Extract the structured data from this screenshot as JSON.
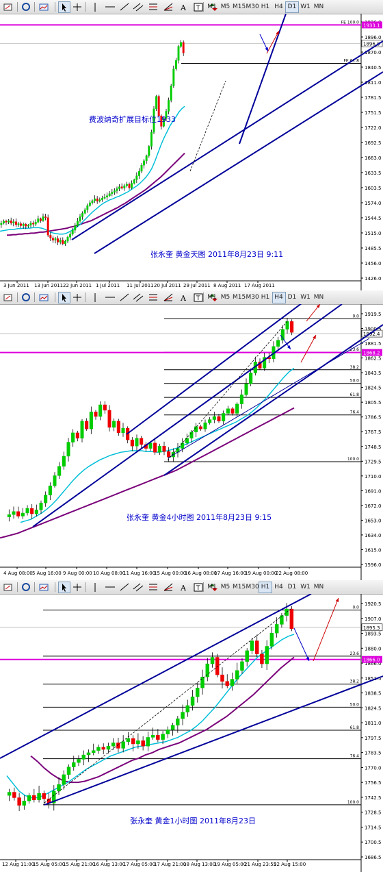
{
  "toolbar": {
    "timeframes": [
      "M1",
      "M5",
      "M15",
      "M30",
      "H1",
      "H4",
      "D1",
      "W1",
      "MN"
    ],
    "tools": [
      "new-order-icon",
      "zoom-icon",
      "chart-icon",
      "cursor-icon",
      "crosshair-icon",
      "line-icon",
      "hline-icon",
      "trendline-icon",
      "channel-icon",
      "fibo-icon",
      "fibo-fan-icon",
      "text-icon",
      "label-icon",
      "arrows-icon"
    ]
  },
  "colors": {
    "bull": "#00cc00",
    "bear": "#ee0000",
    "ma_fast": "#00bfd8",
    "ma_slow": "#7a007a",
    "channel": "#000099",
    "level": "#dd00dd",
    "arrow_up": "#cc0000",
    "arrow_dn": "#0000cc",
    "grid": "#000000"
  },
  "chart_data": [
    {
      "type": "candlestick",
      "active_timeframe": "D1",
      "annotation": "费波纳奇扩展目标位1933",
      "caption": "张永奎    黄金天图     2011年8月23日  9:11",
      "yticks": [
        "1926.0",
        "1896.0",
        "1870.0",
        "1840.5",
        "1811.0",
        "1781.5",
        "1751.5",
        "1722.0",
        "1692.5",
        "1663.0",
        "1633.5",
        "1603.5",
        "1574.0",
        "1544.5",
        "1515.0",
        "1485.5",
        "1456.0",
        "1426.0"
      ],
      "xticks": [
        "3 Jun 2011",
        "13 Jun 2011",
        "22 Jun 2011",
        "1 Jul 2011",
        "11 Jul 2011",
        "20 Jul 2011",
        "29 Jul 2011",
        "8 Aug 2011",
        "17 Aug 2011"
      ],
      "ylim": [
        1426,
        1950
      ],
      "levels": [
        {
          "label": "FE 100.0",
          "price": 1933.0,
          "price_tag": "1933.1",
          "color": "#dd00dd"
        },
        {
          "label": "FE 61.8",
          "price": 1856.0
        }
      ],
      "current_price": "1896.0",
      "candles": [
        1536,
        1540,
        1538,
        1541,
        1536,
        1539,
        1533,
        1535,
        1531,
        1534,
        1530,
        1532,
        1536,
        1534,
        1538,
        1545,
        1541,
        1549,
        1547,
        1512,
        1506,
        1502,
        1505,
        1498,
        1502,
        1495,
        1500,
        1508,
        1514,
        1522,
        1531,
        1540,
        1549,
        1556,
        1563,
        1571,
        1577,
        1581,
        1585,
        1580,
        1583,
        1586,
        1588,
        1591,
        1595,
        1598,
        1601,
        1605,
        1609,
        1606,
        1611,
        1614,
        1607,
        1616,
        1623,
        1631,
        1640,
        1652,
        1661,
        1671,
        1690,
        1718,
        1765,
        1790,
        1751,
        1730,
        1746,
        1760,
        1782,
        1811,
        1845,
        1862,
        1890,
        1898,
        1877
      ],
      "ma_fast": [
        1520,
        1521,
        1522,
        1523,
        1523,
        1524,
        1525,
        1525,
        1526,
        1526,
        1526,
        1527,
        1527,
        1527,
        1526,
        1524,
        1521,
        1518,
        1516,
        1515,
        1514,
        1514,
        1515,
        1518,
        1521,
        1525,
        1529,
        1534,
        1540,
        1546,
        1552,
        1558,
        1563,
        1568,
        1573,
        1577,
        1580,
        1583,
        1585,
        1588,
        1590,
        1593,
        1596,
        1599,
        1603,
        1607,
        1611,
        1616,
        1622,
        1628,
        1636,
        1646,
        1660,
        1676,
        1692,
        1706,
        1718,
        1730,
        1740,
        1748,
        1758,
        1765,
        1770
      ],
      "ma_slow": [
        1512,
        1512,
        1513,
        1513,
        1514,
        1514,
        1515,
        1515,
        1516,
        1516,
        1517,
        1518,
        1518,
        1519,
        1520,
        1521,
        1522,
        1523,
        1524,
        1525,
        1526,
        1528,
        1529,
        1531,
        1533,
        1535,
        1537,
        1539,
        1541,
        1544,
        1547,
        1550,
        1553,
        1556,
        1559,
        1562,
        1565,
        1568,
        1572,
        1575,
        1579,
        1583,
        1587,
        1591,
        1595,
        1599,
        1603,
        1608,
        1613,
        1618,
        1623,
        1628,
        1634,
        1640,
        1646,
        1652,
        1658,
        1664,
        1670,
        1676
      ]
    },
    {
      "type": "candlestick",
      "active_timeframe": "H4",
      "caption": "张永奎    黄金4小时图    2011年8月23日    9:15",
      "yticks": [
        "1919.5",
        "1900.5",
        "1881.5",
        "1862.5",
        "1843.5",
        "1824.5",
        "1805.5",
        "1786.5",
        "1767.5",
        "1748.5",
        "1729.5",
        "1710.0",
        "1691.0",
        "1672.0",
        "1653.0",
        "1634.0",
        "1615.0",
        "1596.0"
      ],
      "xticks": [
        "4 Aug 08:00",
        "5 Aug 16:00",
        "9 Aug 00:00",
        "10 Aug 08:00",
        "11 Aug 16:00",
        "15 Aug 00:00",
        "16 Aug 08:00",
        "17 Aug 16:00",
        "19 Aug 00:00",
        "22 Aug 08:00"
      ],
      "ylim": [
        1596,
        1925
      ],
      "levels": [
        {
          "label": "0.0",
          "price": 1911.5
        },
        {
          "label": "23.6",
          "price": 1868.5
        },
        {
          "label": "38.2",
          "price": 1846.0
        },
        {
          "label": "50.0",
          "price": 1828.5
        },
        {
          "label": "61.8",
          "price": 1810.5
        },
        {
          "label": "76.4",
          "price": 1788.0
        },
        {
          "label": "100.0",
          "price": 1728.0
        }
      ],
      "magenta_level": {
        "price": 1868.2,
        "price_tag": "1868.2"
      },
      "current_price": "1892.4",
      "candles": [
        1660,
        1664,
        1658,
        1662,
        1668,
        1661,
        1666,
        1675,
        1685,
        1697,
        1710,
        1722,
        1735,
        1753,
        1765,
        1758,
        1780,
        1770,
        1792,
        1786,
        1801,
        1794,
        1772,
        1780,
        1765,
        1771,
        1756,
        1748,
        1758,
        1750,
        1745,
        1752,
        1740,
        1748,
        1741,
        1734,
        1740,
        1745,
        1752,
        1758,
        1766,
        1773,
        1770,
        1778,
        1782,
        1786,
        1780,
        1790,
        1796,
        1790,
        1802,
        1814,
        1828,
        1842,
        1856,
        1848,
        1862,
        1860,
        1876,
        1884,
        1898,
        1908,
        1894
      ],
      "ma_fast": [
        1650,
        1652,
        1654,
        1658,
        1662,
        1667,
        1673,
        1680,
        1688,
        1696,
        1704,
        1711,
        1717,
        1722,
        1726,
        1730,
        1733,
        1736,
        1738,
        1740,
        1741,
        1742,
        1742,
        1742,
        1741,
        1741,
        1740,
        1741,
        1742,
        1744,
        1746,
        1749,
        1752,
        1755,
        1758,
        1761,
        1764,
        1767,
        1770,
        1773,
        1776,
        1779,
        1783,
        1787,
        1792,
        1798,
        1805,
        1812,
        1820,
        1828,
        1836,
        1843,
        1848
      ],
      "ma_slow": [
        1630,
        1632,
        1634,
        1636,
        1639,
        1642,
        1645,
        1648,
        1651,
        1654,
        1657,
        1660,
        1663,
        1666,
        1669,
        1672,
        1675,
        1678,
        1681,
        1684,
        1687,
        1690,
        1693,
        1696,
        1699,
        1702,
        1705,
        1708,
        1711,
        1714,
        1717,
        1721,
        1725,
        1729,
        1733,
        1737,
        1741,
        1745,
        1749,
        1753,
        1757,
        1761,
        1765,
        1769,
        1773,
        1777,
        1781,
        1785,
        1789,
        1793,
        1797
      ]
    },
    {
      "type": "candlestick",
      "active_timeframe": "H1",
      "caption": "张永奎    黄金1小时图    2011年8月23日",
      "yticks": [
        "1920.5",
        "1907.0",
        "1893.5",
        "1880.0",
        "1866.0",
        "1852.5",
        "1838.5",
        "1824.5",
        "1811.0",
        "1797.5",
        "1783.5",
        "1770.0",
        "1756.5",
        "1742.5",
        "1728.5",
        "1714.5",
        "1700.5",
        "1686.5"
      ],
      "xticks": [
        "12 Aug 11:00",
        "15 Aug 05:00",
        "15 Aug 21:00",
        "16 Aug 13:00",
        "17 Aug 05:00",
        "17 Aug 21:00",
        "18 Aug 13:00",
        "19 Aug 05:00",
        "21 Aug 23:55",
        "22 Aug 15:00"
      ],
      "ylim": [
        1686,
        1922
      ],
      "levels": [
        {
          "label": "0.0",
          "price": 1911.0
        },
        {
          "label": "23.6",
          "price": 1869.0
        },
        {
          "label": "38.2",
          "price": 1843.5
        },
        {
          "label": "50.0",
          "price": 1822.5
        },
        {
          "label": "61.8",
          "price": 1801.5
        },
        {
          "label": "76.4",
          "price": 1775.5
        },
        {
          "label": "100.0",
          "price": 1733.5
        }
      ],
      "magenta_level": {
        "price": 1866.0,
        "price_tag": "1866.0"
      },
      "current_price": "1895.3",
      "candles": [
        1745,
        1740,
        1733,
        1737,
        1742,
        1738,
        1744,
        1739,
        1735,
        1746,
        1752,
        1761,
        1768,
        1772,
        1775,
        1779,
        1781,
        1783,
        1786,
        1784,
        1787,
        1790,
        1785,
        1791,
        1794,
        1789,
        1792,
        1787,
        1795,
        1797,
        1793,
        1798,
        1802,
        1806,
        1812,
        1818,
        1824,
        1832,
        1840,
        1850,
        1862,
        1868,
        1852,
        1846,
        1842,
        1848,
        1856,
        1864,
        1874,
        1883,
        1871,
        1862,
        1878,
        1890,
        1898,
        1906,
        1912,
        1894
      ],
      "ma_fast": [
        1760,
        1753,
        1746,
        1742,
        1740,
        1740,
        1742,
        1745,
        1748,
        1751,
        1754,
        1758,
        1762,
        1766,
        1769,
        1772,
        1775,
        1778,
        1780,
        1782,
        1784,
        1786,
        1787,
        1788,
        1789,
        1790,
        1791,
        1793,
        1795,
        1798,
        1801,
        1805,
        1810,
        1816,
        1822,
        1829,
        1836,
        1843,
        1850,
        1856,
        1862,
        1868,
        1872,
        1876,
        1880,
        1884,
        1887,
        1889
      ],
      "ma_slow": [
        1778,
        1773,
        1767,
        1762,
        1758,
        1755,
        1754,
        1754,
        1755,
        1757,
        1759,
        1762,
        1765,
        1768,
        1771,
        1774,
        1776,
        1779,
        1781,
        1784,
        1786,
        1788,
        1790,
        1793,
        1796,
        1799,
        1802,
        1806,
        1810,
        1814,
        1819,
        1824,
        1829,
        1834,
        1840,
        1846,
        1852,
        1858,
        1863,
        1868
      ]
    }
  ]
}
